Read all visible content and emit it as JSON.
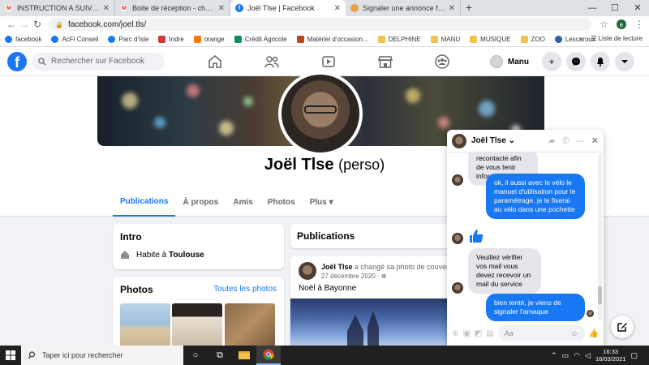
{
  "browser": {
    "tabs": [
      {
        "title": "INSTRUCTION A SUIVRE - chatel...",
        "icon": "gmail-icon",
        "active": false
      },
      {
        "title": "Boite de réception - chatel.alexis...",
        "icon": "gmail-icon",
        "active": false
      },
      {
        "title": "Joël Tlse | Facebook",
        "icon": "facebook-icon",
        "active": true
      },
      {
        "title": "Signaler une annonce frauduleuse",
        "icon": "web-icon",
        "active": false
      }
    ],
    "url": "facebook.com/joel.tls/",
    "profile_initial": "e",
    "bookmarks": [
      "facebook",
      "AcFl Conseil",
      "Parc d'Isle",
      "Indre",
      "orange",
      "Crédit Agricole",
      "Matériel d'occasion...",
      "DELPHINE",
      "MANU",
      "MUSIQUE",
      "ZOO",
      "Lescaroux"
    ],
    "reading_list": "Liste de lecture"
  },
  "facebook": {
    "search_placeholder": "Rechercher sur Facebook",
    "user_name": "Manu"
  },
  "profile": {
    "name": "Joël Tlse",
    "suffix": "(perso)",
    "tabs": [
      "Publications",
      "À propos",
      "Amis",
      "Photos",
      "Plus"
    ],
    "active_tab": "Publications"
  },
  "intro": {
    "title": "Intro",
    "lives_prefix": "Habite à",
    "lives_city": "Toulouse"
  },
  "photos": {
    "title": "Photos",
    "see_all": "Toutes les photos"
  },
  "publications": {
    "title": "Publications",
    "post": {
      "author": "Joël Tlse",
      "action": "a changé sa photo de couvert...",
      "date": "27 décembre 2020 ·",
      "text": "Noël à Bayonne"
    }
  },
  "chat": {
    "contact": "Joël Tlse",
    "messages": [
      {
        "from": "them",
        "text": "recontacte afin de vous tenir informé"
      },
      {
        "from": "me",
        "text": "ok, il aussi avec le vélo le manuel d'utilisation pour le paramétrage. je le fixerai au vélo dans une pochette"
      },
      {
        "from": "them",
        "text": "👍"
      },
      {
        "from": "them",
        "text": "Veuillez vérifier vos mail vous devez recevoir un mail du service"
      },
      {
        "from": "me",
        "text": "bien tenté, je viens de signaler l'arnaque"
      }
    ],
    "input_placeholder": "Aa"
  },
  "taskbar": {
    "search_placeholder": "Taper ici pour rechercher",
    "time": "16:33",
    "date": "16/03/2021"
  }
}
